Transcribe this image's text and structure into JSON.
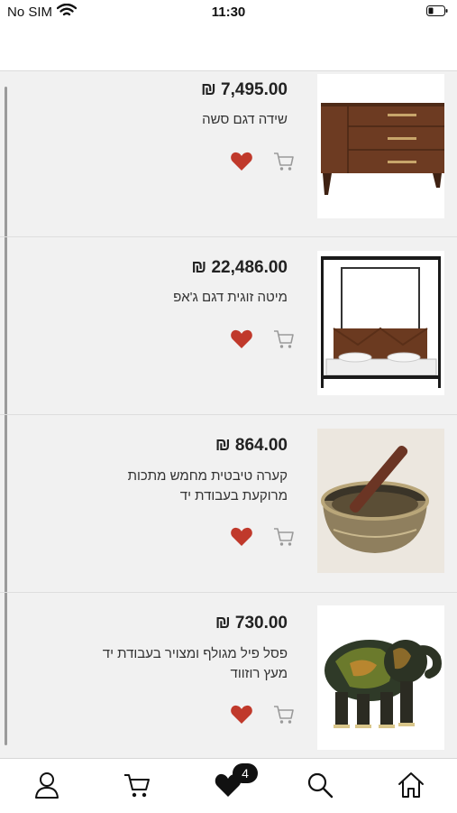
{
  "status_bar": {
    "carrier": "No SIM",
    "time": "11:30"
  },
  "products": [
    {
      "price": "₪ 7,495.00",
      "title": "שידה דגם סשה",
      "image": "dresser-image",
      "favorite": true
    },
    {
      "price": "₪ 22,486.00",
      "title": "מיטה זוגית דגם ג'אפ",
      "image": "canopy-bed-image",
      "favorite": true
    },
    {
      "price": "₪ 864.00",
      "title": "קערה טיבטית מחמש מתכות מרוקעת בעבודת יד",
      "image": "singing-bowl-image",
      "favorite": true
    },
    {
      "price": "₪ 730.00",
      "title": "פסל פיל מגולף ומצויר בעבודת יד מעץ רוזווד",
      "image": "elephant-statue-image",
      "favorite": true
    }
  ],
  "tabbar": {
    "items": [
      "profile-icon",
      "cart-icon",
      "favorites-icon",
      "search-icon",
      "home-icon"
    ],
    "favorites_badge": "4"
  },
  "colors": {
    "background": "#f1f1f1",
    "heart": "#c0392b",
    "badge": "#111111"
  }
}
